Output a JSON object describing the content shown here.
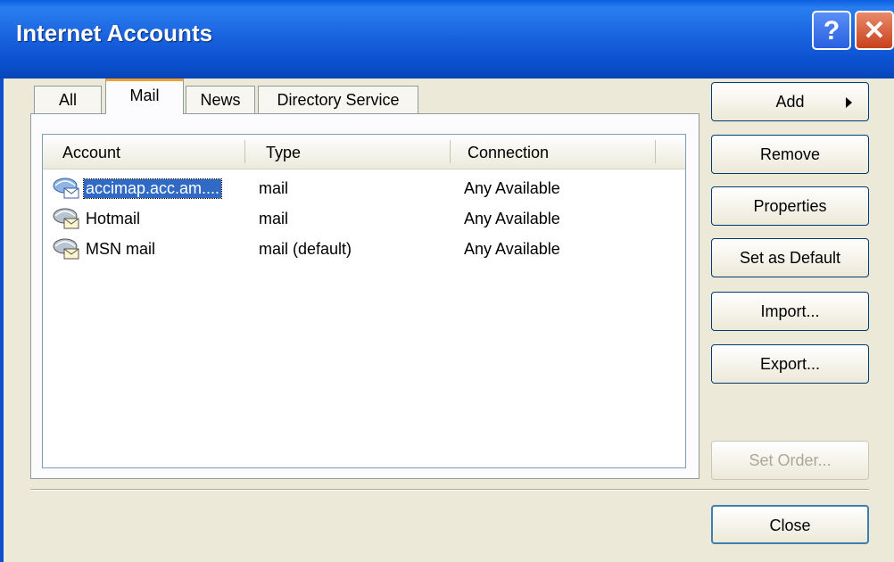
{
  "window": {
    "title": "Internet Accounts",
    "help_glyph": "?",
    "close_glyph": "✕"
  },
  "tabs": [
    {
      "label": "All",
      "active": false
    },
    {
      "label": "Mail",
      "active": true
    },
    {
      "label": "News",
      "active": false
    },
    {
      "label": "Directory Service",
      "active": false
    }
  ],
  "columns": [
    "Account",
    "Type",
    "Connection"
  ],
  "rows": [
    {
      "account": "accimap.acc.am....",
      "type": "mail",
      "connection": "Any Available",
      "selected": true,
      "icon": "mail-server-icon"
    },
    {
      "account": "Hotmail",
      "type": "mail",
      "connection": "Any Available",
      "selected": false,
      "icon": "mail-account-icon"
    },
    {
      "account": "MSN mail",
      "type": "mail (default)",
      "connection": "Any Available",
      "selected": false,
      "icon": "mail-account-icon"
    }
  ],
  "buttons": {
    "add": "Add",
    "remove": "Remove",
    "properties": "Properties",
    "set_default": "Set as Default",
    "import": "Import...",
    "export": "Export...",
    "set_order": "Set Order...",
    "close": "Close"
  },
  "colors": {
    "selection": "#316ac5",
    "titlebar": "#0a50d0",
    "face": "#ece9d8",
    "tab_highlight": "#f0a030"
  }
}
